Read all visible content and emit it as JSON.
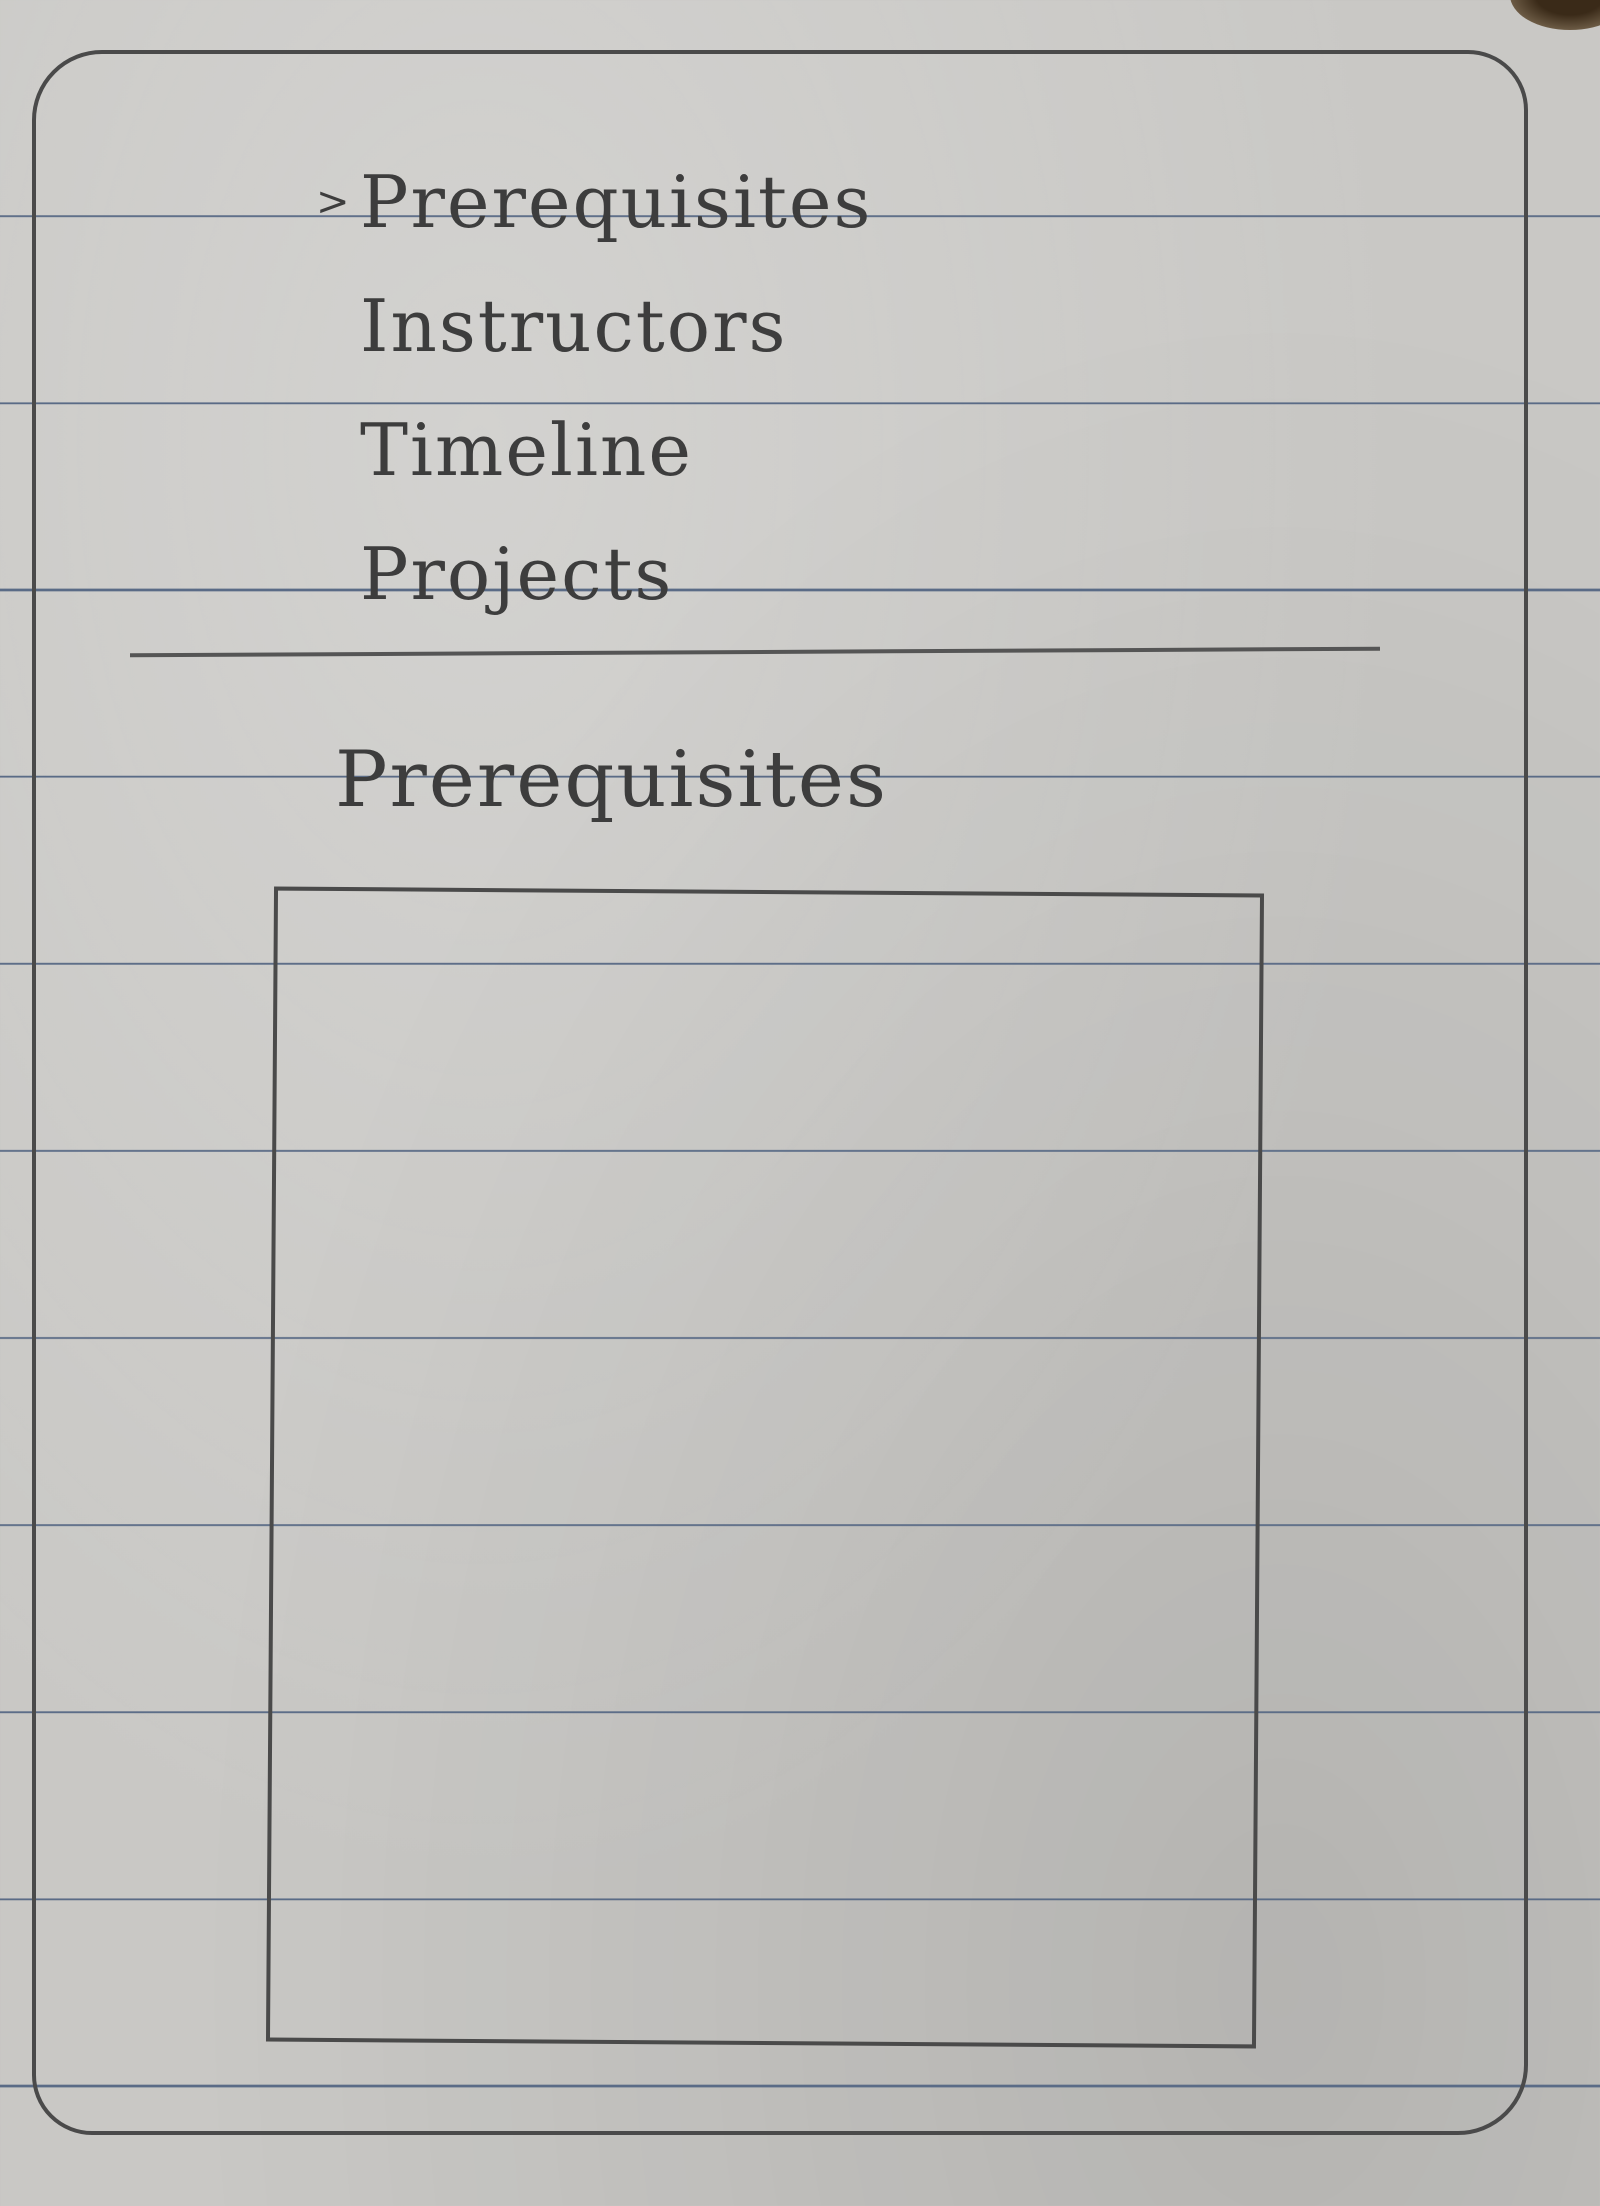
{
  "nav": {
    "active_marker": ">",
    "items": [
      {
        "label": "Prerequisites",
        "active": true
      },
      {
        "label": "Instructors",
        "active": false
      },
      {
        "label": "Timeline",
        "active": false
      },
      {
        "label": "Projects",
        "active": false
      }
    ]
  },
  "main": {
    "section_title": "Prerequisites",
    "content": ""
  }
}
